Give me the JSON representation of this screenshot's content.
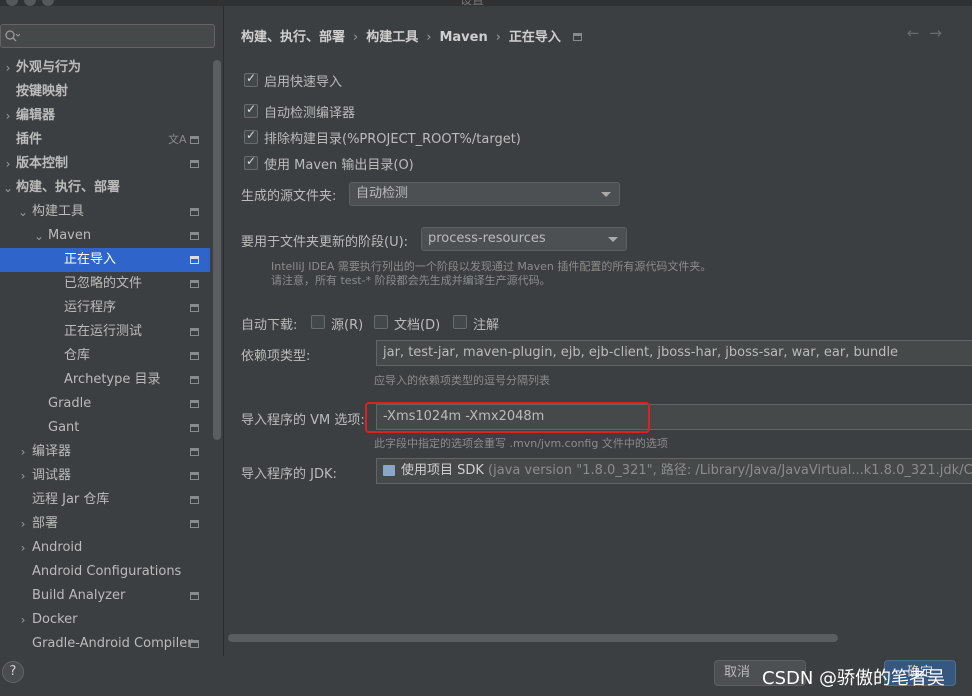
{
  "window": {
    "title": "设置"
  },
  "search": {
    "placeholder": ""
  },
  "sidebar": {
    "items": [
      {
        "label": "外观与行为",
        "arrow": "›",
        "bold": true
      },
      {
        "label": "按键映射",
        "bold": true
      },
      {
        "label": "编辑器",
        "arrow": "›",
        "bold": true
      },
      {
        "label": "插件",
        "bold": true,
        "lang_icon": "文A"
      },
      {
        "label": "版本控制",
        "arrow": "›",
        "bold": true
      },
      {
        "label": "构建、执行、部署",
        "arrow": "⌄",
        "bold": true
      },
      {
        "label": "构建工具",
        "arrow": "⌄"
      },
      {
        "label": "Maven",
        "arrow": "⌄"
      },
      {
        "label": "正在导入",
        "selected": true
      },
      {
        "label": "已忽略的文件"
      },
      {
        "label": "运行程序"
      },
      {
        "label": "正在运行测试"
      },
      {
        "label": "仓库"
      },
      {
        "label": "Archetype 目录"
      },
      {
        "label": "Gradle"
      },
      {
        "label": "Gant"
      },
      {
        "label": "编译器",
        "arrow": "›"
      },
      {
        "label": "调试器",
        "arrow": "›"
      },
      {
        "label": "远程 Jar 仓库"
      },
      {
        "label": "部署",
        "arrow": "›"
      },
      {
        "label": "Android",
        "arrow": "›"
      },
      {
        "label": "Android Configurations"
      },
      {
        "label": "Build Analyzer"
      },
      {
        "label": "Docker",
        "arrow": "›"
      },
      {
        "label": "Gradle-Android Compiler"
      }
    ]
  },
  "breadcrumb": {
    "items": [
      "构建、执行、部署",
      "构建工具",
      "Maven",
      "正在导入"
    ],
    "separator": "›"
  },
  "nav": {
    "back": "←",
    "forward": "→"
  },
  "main": {
    "checkboxes": [
      {
        "label": "启用快速导入",
        "checked": true
      },
      {
        "label": "自动检测编译器",
        "checked": true
      },
      {
        "label": "排除构建目录(%PROJECT_ROOT%/target)",
        "checked": true
      },
      {
        "label": "使用 Maven 输出目录(O)",
        "checked": true
      }
    ],
    "source_folder": {
      "label": "生成的源文件夹:",
      "value": "自动检测"
    },
    "phase": {
      "label": "要用于文件夹更新的阶段(U):",
      "value": "process-resources",
      "hint_line1": "IntelliJ IDEA 需要执行列出的一个阶段以发现通过 Maven 插件配置的所有源代码文件夹。",
      "hint_line2": "请注意，所有 test-* 阶段都会先生成并编译生产源代码。"
    },
    "auto_download": {
      "label": "自动下载:",
      "options": [
        {
          "label": "源(R)",
          "checked": false
        },
        {
          "label": "文档(D)",
          "checked": false
        },
        {
          "label": "注解",
          "checked": false
        }
      ]
    },
    "dependency_types": {
      "label": "依赖项类型:",
      "value": "jar, test-jar, maven-plugin, ejb, ejb-client, jboss-har, jboss-sar, war, ear, bundle",
      "hint": "应导入的依赖项类型的逗号分隔列表"
    },
    "vm_options": {
      "label": "导入程序的 VM 选项:",
      "value": "-Xms1024m -Xmx2048m",
      "hint": "此字段中指定的选项会重写 .mvn/jvm.config 文件中的选项",
      "highlight_color": "#e02020"
    },
    "jdk": {
      "label": "导入程序的 JDK:",
      "value_main": "使用项目 SDK",
      "value_detail": " (java version \"1.8.0_321\", 路径: /Library/Java/JavaVirtual...k1.8.0_321.jdk/Cont"
    }
  },
  "footer": {
    "help": "?",
    "cancel": "取消",
    "ok": "确定",
    "watermark": "CSDN @骄傲的笔者吴"
  },
  "colors": {
    "selection": "#2f65ca",
    "background": "#3c3f41",
    "highlight": "#e02020"
  }
}
